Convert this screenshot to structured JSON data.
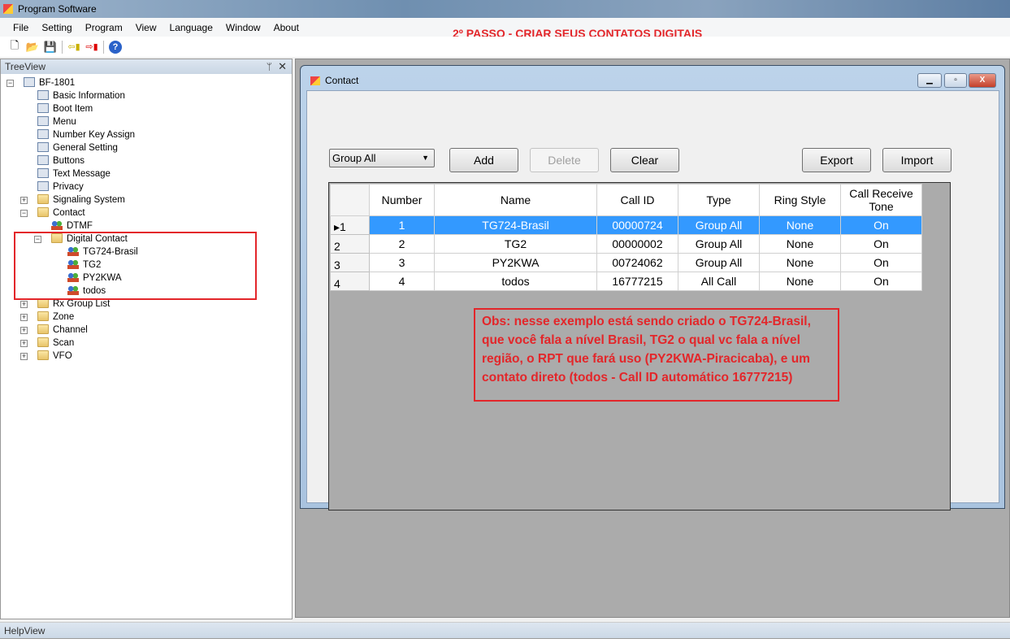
{
  "app": {
    "title": "Program Software"
  },
  "menu": [
    "File",
    "Setting",
    "Program",
    "View",
    "Language",
    "Window",
    "About"
  ],
  "headline": "2º PASSO - CRIAR SEUS CONTATOS DIGITAIS",
  "toolbar": {
    "icons": [
      "new-file-icon",
      "open-folder-icon",
      "save-icon",
      "read-radio-icon",
      "write-radio-icon",
      "help-icon"
    ]
  },
  "treeview": {
    "title": "TreeView",
    "root": "BF-1801",
    "items": [
      "Basic Information",
      "Boot Item",
      "Menu",
      "Number Key Assign",
      "General Setting",
      "Buttons",
      "Text Message",
      "Privacy",
      "Signaling System",
      "Contact"
    ],
    "contact_children": [
      "DTMF",
      "Digital Contact"
    ],
    "digital_contacts": [
      "TG724-Brasil",
      "TG2",
      "PY2KWA",
      "todos"
    ],
    "after": [
      "Rx Group List",
      "Zone",
      "Channel",
      "Scan",
      "VFO"
    ]
  },
  "contact_window": {
    "title": "Contact",
    "filter": "Group All",
    "buttons": {
      "add": "Add",
      "delete": "Delete",
      "clear": "Clear",
      "export": "Export",
      "import": "Import"
    },
    "columns": [
      "Number",
      "Name",
      "Call ID",
      "Type",
      "Ring Style",
      "Call Receive Tone"
    ],
    "rows": [
      {
        "row": "1",
        "number": "1",
        "name": "TG724-Brasil",
        "call_id": "00000724",
        "type": "Group All",
        "ring": "None",
        "tone": "On"
      },
      {
        "row": "2",
        "number": "2",
        "name": "TG2",
        "call_id": "00000002",
        "type": "Group All",
        "ring": "None",
        "tone": "On"
      },
      {
        "row": "3",
        "number": "3",
        "name": "PY2KWA",
        "call_id": "00724062",
        "type": "Group All",
        "ring": "None",
        "tone": "On"
      },
      {
        "row": "4",
        "number": "4",
        "name": "todos",
        "call_id": "16777215",
        "type": "All Call",
        "ring": "None",
        "tone": "On"
      }
    ],
    "selected_row": 1
  },
  "note": "Obs: nesse exemplo está sendo criado o TG724-Brasil, que você fala a nível Brasil, TG2 o qual vc fala a nível região, o RPT que fará uso (PY2KWA-Piracicaba), e um contato direto (todos - Call ID automático 16777215)",
  "helpview": {
    "title": "HelpView"
  },
  "colors": {
    "annotation": "#e3262a",
    "selection": "#3399ff",
    "mdi_bg": "#ababab"
  }
}
